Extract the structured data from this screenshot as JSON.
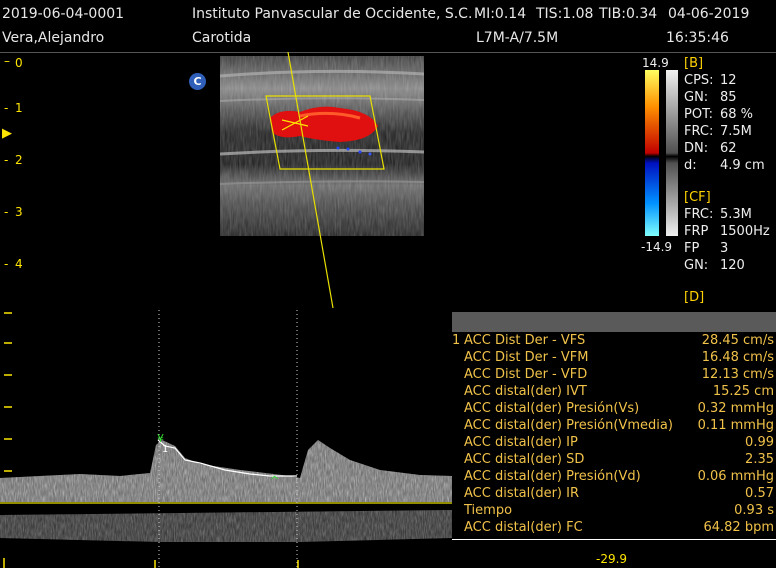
{
  "header": {
    "study_id": "2019-06-04-0001",
    "institution": "Instituto Panvascular de Occidente, S.C.",
    "mi": "MI:0.14",
    "tis": "TIS:1.08",
    "tib": "TIB:0.34",
    "date": "04-06-2019",
    "patient": "Vera,Alejandro",
    "exam": "Carotida",
    "probe": "L7M-A/7.5M",
    "time": "16:35:46"
  },
  "depth_scale": [
    "0",
    "1",
    "2",
    "3",
    "4"
  ],
  "color_scale": {
    "max": "14.9",
    "min": "-14.9"
  },
  "b_mode": {
    "section": "[B]",
    "params": [
      {
        "k": "CPS:",
        "v": "12"
      },
      {
        "k": "GN:",
        "v": "85"
      },
      {
        "k": "POT:",
        "v": "68 %"
      },
      {
        "k": "FRC:",
        "v": "7.5M"
      },
      {
        "k": "DN:",
        "v": "62"
      },
      {
        "k": "d:",
        "v": "4.9 cm"
      }
    ]
  },
  "cf_mode": {
    "section": "[CF]",
    "params": [
      {
        "k": "FRC:",
        "v": "5.3M"
      },
      {
        "k": "FRP",
        "v": "1500Hz"
      },
      {
        "k": "FP",
        "v": "3"
      },
      {
        "k": "GN:",
        "v": "120"
      }
    ]
  },
  "d_mode": {
    "section": "[D]"
  },
  "icons": {
    "color_mode": "C"
  },
  "measurements": [
    {
      "n": "1",
      "label": "ACC Dist Der - VFS",
      "value": "28.45 cm/s"
    },
    {
      "n": "",
      "label": "ACC Dist Der - VFM",
      "value": "16.48 cm/s"
    },
    {
      "n": "",
      "label": "ACC Dist Der - VFD",
      "value": "12.13 cm/s"
    },
    {
      "n": "",
      "label": "ACC distal(der) IVT",
      "value": "15.25 cm"
    },
    {
      "n": "",
      "label": "ACC distal(der) Presión(Vs)",
      "value": "0.32 mmHg"
    },
    {
      "n": "",
      "label": "ACC distal(der) Presión(Vmedia)",
      "value": "0.11 mmHg"
    },
    {
      "n": "",
      "label": "ACC distal(der) IP",
      "value": "0.99"
    },
    {
      "n": "",
      "label": "ACC distal(der) SD",
      "value": "2.35"
    },
    {
      "n": "",
      "label": "ACC distal(der) Presión(Vd)",
      "value": "0.06 mmHg"
    },
    {
      "n": "",
      "label": "ACC distal(der) IR",
      "value": "0.57"
    },
    {
      "n": "",
      "label": "Tiempo",
      "value": "0.93 s"
    },
    {
      "n": "",
      "label": "ACC distal(der) FC",
      "value": "64.82 bpm"
    }
  ],
  "doppler": {
    "baseline_value": "-29.9",
    "marker_label": "1"
  }
}
